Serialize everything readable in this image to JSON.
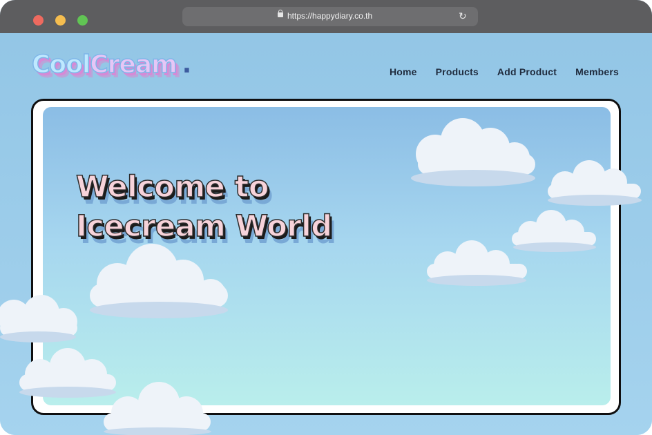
{
  "browser": {
    "url": "https://happydiary.co.th",
    "lock_icon": "lock-icon",
    "reload_icon": "reload-icon",
    "traffic_lights": [
      "#ee6a5f",
      "#f5bd4f",
      "#61c454"
    ]
  },
  "header": {
    "logo": {
      "part1": "Cool",
      "part2": "Cream",
      "dot": "."
    },
    "nav": [
      {
        "label": "Home"
      },
      {
        "label": "Products"
      },
      {
        "label": "Add Product"
      },
      {
        "label": "Members"
      }
    ]
  },
  "hero": {
    "title_line1": "Welcome to",
    "title_line2": "Icecream World"
  },
  "colors": {
    "page_bg": "#9dcbe8",
    "hero_top": "#8bbde5",
    "hero_bottom": "#b9eeec",
    "title_fill": "#f7d3da",
    "nav_text": "#1f2b3d"
  }
}
